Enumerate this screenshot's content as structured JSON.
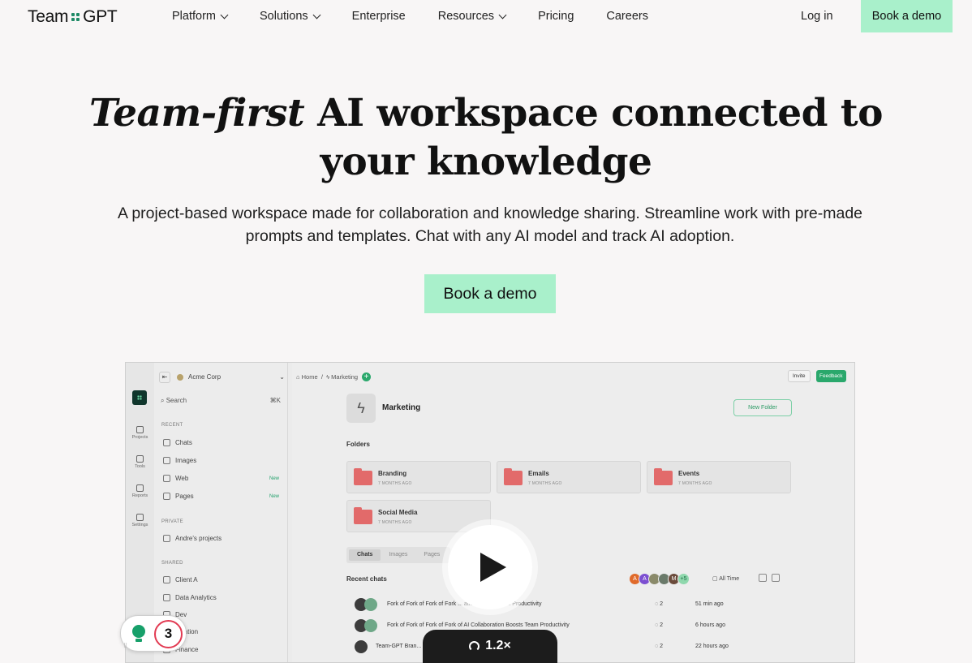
{
  "brand": {
    "name_left": "Team",
    "name_right": "GPT",
    "accent": "#1f8a66"
  },
  "nav": {
    "items": [
      {
        "label": "Platform",
        "has_menu": true
      },
      {
        "label": "Solutions",
        "has_menu": true
      },
      {
        "label": "Enterprise",
        "has_menu": false
      },
      {
        "label": "Resources",
        "has_menu": true
      },
      {
        "label": "Pricing",
        "has_menu": false
      },
      {
        "label": "Careers",
        "has_menu": false
      }
    ],
    "login": "Log in",
    "demo": "Book a demo"
  },
  "hero": {
    "title_italic": "Team-first",
    "title_rest_line1": " AI workspace connected to",
    "title_line2": "your knowledge",
    "subtitle": "A project-based workspace made for collaboration and knowledge sharing. Streamline work with pre-made prompts and templates. Chat with any AI model and track AI adoption.",
    "cta": "Book a demo",
    "cta_color": "#a9f0cb"
  },
  "app": {
    "org": "Acme Corp",
    "search": "Search",
    "search_shortcut": "⌘K",
    "rail": [
      "Projects",
      "Tools",
      "Reports",
      "Settings"
    ],
    "recent_label": "RECENT",
    "recent": [
      {
        "label": "Chats",
        "badge": ""
      },
      {
        "label": "Images",
        "badge": ""
      },
      {
        "label": "Web",
        "badge": "New"
      },
      {
        "label": "Pages",
        "badge": "New"
      }
    ],
    "private_label": "PRIVATE",
    "private": [
      "Andre's projects"
    ],
    "shared_label": "SHARED",
    "shared": [
      "Client A",
      "Data Analytics",
      "Dev",
      "...cation",
      "Finance"
    ],
    "breadcrumb": {
      "home": "Home",
      "sep": "/",
      "current": "Marketing"
    },
    "invite": "Invite",
    "feedback": "Feedback",
    "project_title": "Marketing",
    "new_folder": "New Folder",
    "folders_label": "Folders",
    "folders": [
      {
        "name": "Branding",
        "date": "7 MONTHS AGO"
      },
      {
        "name": "Emails",
        "date": "7 MONTHS AGO"
      },
      {
        "name": "Events",
        "date": "7 MONTHS AGO"
      },
      {
        "name": "Social Media",
        "date": "7 MONTHS AGO"
      }
    ],
    "tabs": [
      "Chats",
      "Images",
      "Pages"
    ],
    "recent_chats_label": "Recent chats",
    "avatar_letters": [
      "A",
      "A",
      "",
      "",
      "M"
    ],
    "avatar_more": "+5",
    "filter": "All Time",
    "chats": [
      {
        "title": "Fork of Fork of Fork of Fork ... ation Boosts Team Productivity",
        "comments": "2",
        "time": "51 min ago"
      },
      {
        "title": "Fork of Fork of Fork of Fork of AI Collaboration Boosts Team Productivity",
        "comments": "2",
        "time": "6 hours ago"
      },
      {
        "title": "Team-GPT Bran...",
        "comments": "2",
        "time": "22 hours ago"
      }
    ]
  },
  "video": {
    "speed": "1.2×"
  },
  "badge_widget": {
    "count": "3"
  }
}
